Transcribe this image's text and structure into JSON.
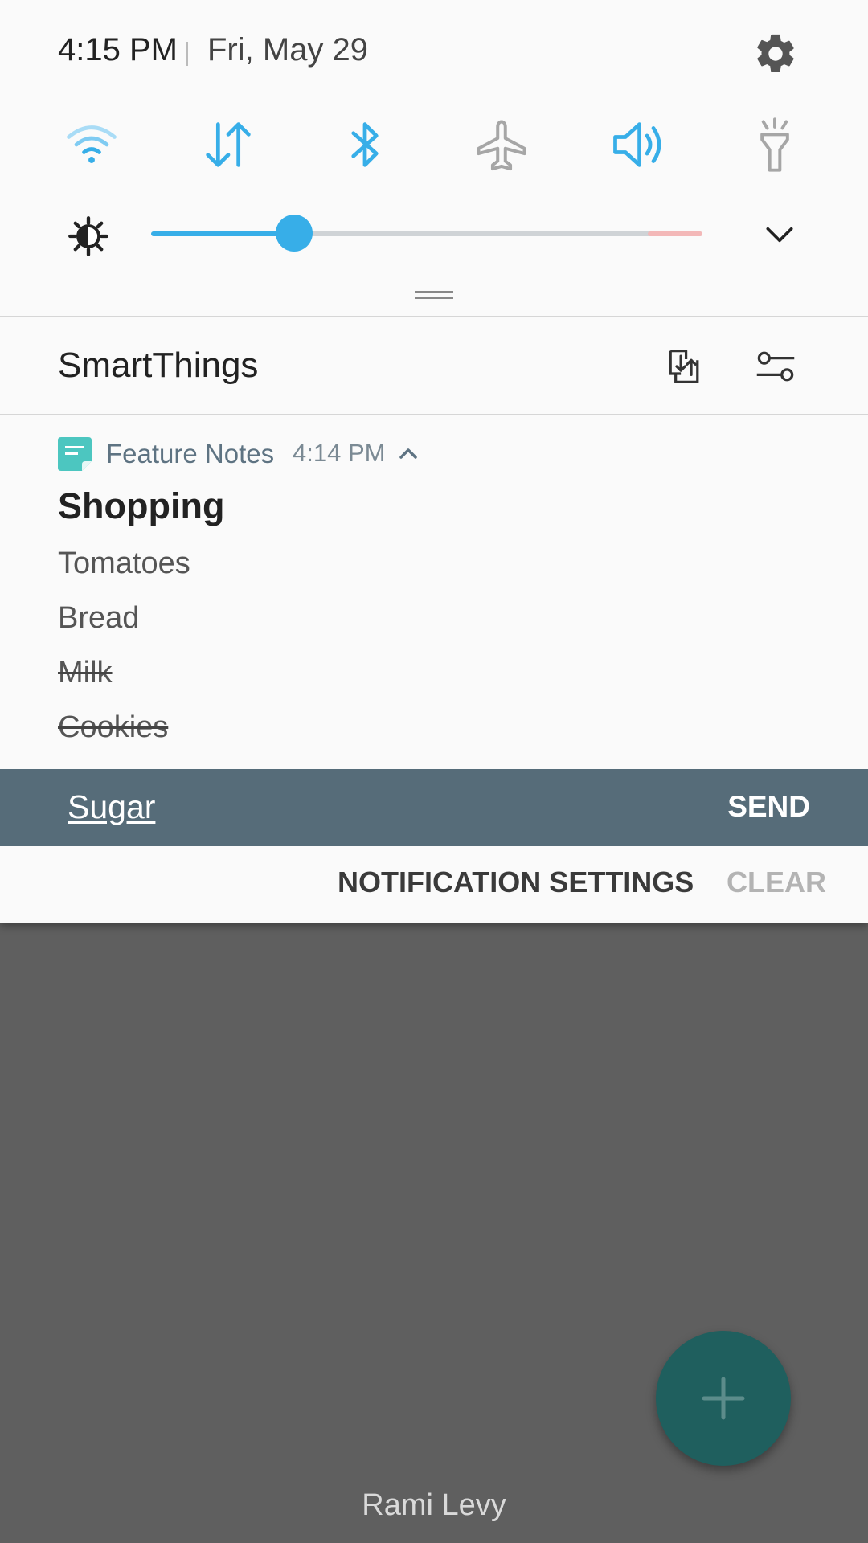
{
  "status": {
    "time": "4:15 PM",
    "date": "Fri, May 29"
  },
  "quick_settings": {
    "toggles": [
      {
        "name": "wifi",
        "icon": "wifi-icon",
        "state": "on-low"
      },
      {
        "name": "mobile-data",
        "icon": "data-arrows-icon",
        "state": "on"
      },
      {
        "name": "bluetooth",
        "icon": "bluetooth-icon",
        "state": "on"
      },
      {
        "name": "airplane-mode",
        "icon": "airplane-icon",
        "state": "off"
      },
      {
        "name": "sound",
        "icon": "volume-icon",
        "state": "on"
      },
      {
        "name": "flashlight",
        "icon": "flashlight-icon",
        "state": "off"
      }
    ],
    "brightness_level": 0.26,
    "accent_color": "#37aee8",
    "inactive_color": "#a6a6a6"
  },
  "smartthings": {
    "title": "SmartThings"
  },
  "notification": {
    "app": "Feature Notes",
    "time": "4:14 PM",
    "title": "Shopping",
    "items": [
      {
        "text": "Tomatoes",
        "done": false
      },
      {
        "text": "Bread",
        "done": false
      },
      {
        "text": "Milk",
        "done": true
      },
      {
        "text": "Cookies",
        "done": true
      }
    ],
    "reply_text": "Sugar",
    "send_label": "SEND"
  },
  "actions": {
    "notification_settings": "NOTIFICATION SETTINGS",
    "clear": "CLEAR"
  },
  "background": {
    "label": "Rami Levy"
  }
}
